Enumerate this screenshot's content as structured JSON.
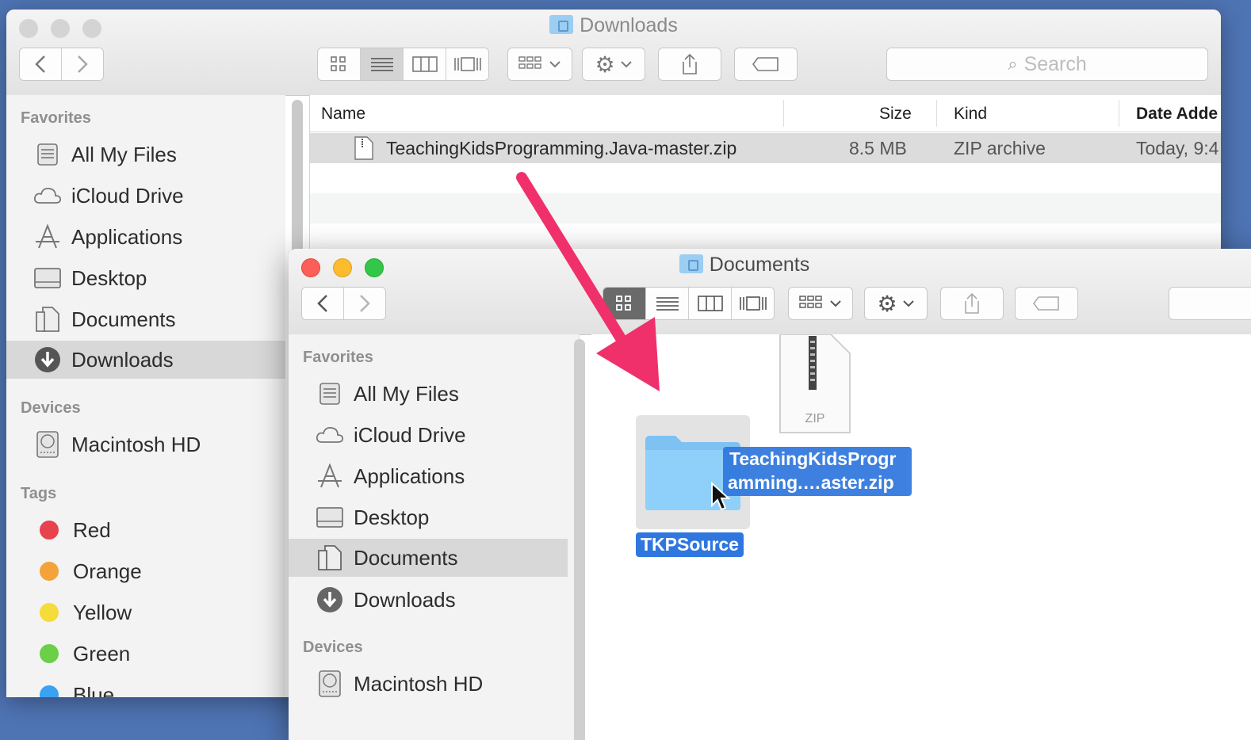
{
  "back_window": {
    "title": "Downloads",
    "search_placeholder": "Search",
    "sidebar": {
      "favorites_header": "Favorites",
      "favorites": [
        {
          "label": "All My Files",
          "icon": "all-files-icon"
        },
        {
          "label": "iCloud Drive",
          "icon": "cloud-icon"
        },
        {
          "label": "Applications",
          "icon": "applications-icon"
        },
        {
          "label": "Desktop",
          "icon": "desktop-icon"
        },
        {
          "label": "Documents",
          "icon": "documents-icon"
        },
        {
          "label": "Downloads",
          "icon": "downloads-icon",
          "selected": true
        }
      ],
      "devices_header": "Devices",
      "devices": [
        {
          "label": "Macintosh HD",
          "icon": "hard-drive-icon"
        }
      ],
      "tags_header": "Tags",
      "tags": [
        {
          "label": "Red",
          "color": "#e8424f"
        },
        {
          "label": "Orange",
          "color": "#f3a33a"
        },
        {
          "label": "Yellow",
          "color": "#f5dc3b"
        },
        {
          "label": "Green",
          "color": "#6bcf48"
        },
        {
          "label": "Blue",
          "color": "#3aa2f1"
        }
      ]
    },
    "columns": {
      "name": "Name",
      "size": "Size",
      "kind": "Kind",
      "date": "Date Adde"
    },
    "files": [
      {
        "name": "TeachingKidsProgramming.Java-master.zip",
        "size": "8.5 MB",
        "kind": "ZIP archive",
        "date": "Today, 9:4"
      }
    ]
  },
  "front_window": {
    "title": "Documents",
    "sidebar": {
      "favorites_header": "Favorites",
      "favorites": [
        {
          "label": "All My Files",
          "icon": "all-files-icon"
        },
        {
          "label": "iCloud Drive",
          "icon": "cloud-icon"
        },
        {
          "label": "Applications",
          "icon": "applications-icon"
        },
        {
          "label": "Desktop",
          "icon": "desktop-icon"
        },
        {
          "label": "Documents",
          "icon": "documents-icon",
          "selected": true
        },
        {
          "label": "Downloads",
          "icon": "downloads-icon"
        }
      ],
      "devices_header": "Devices",
      "devices": [
        {
          "label": "Macintosh HD",
          "icon": "hard-drive-icon"
        }
      ]
    },
    "items": {
      "folder_name": "TKPSource",
      "zip_badge": "ZIP",
      "drag_label_line1": "TeachingKidsProgr",
      "drag_label_line2": "amming.…aster.zip"
    }
  },
  "colors": {
    "arrow": "#f0306b",
    "selection": "#2f77de"
  }
}
